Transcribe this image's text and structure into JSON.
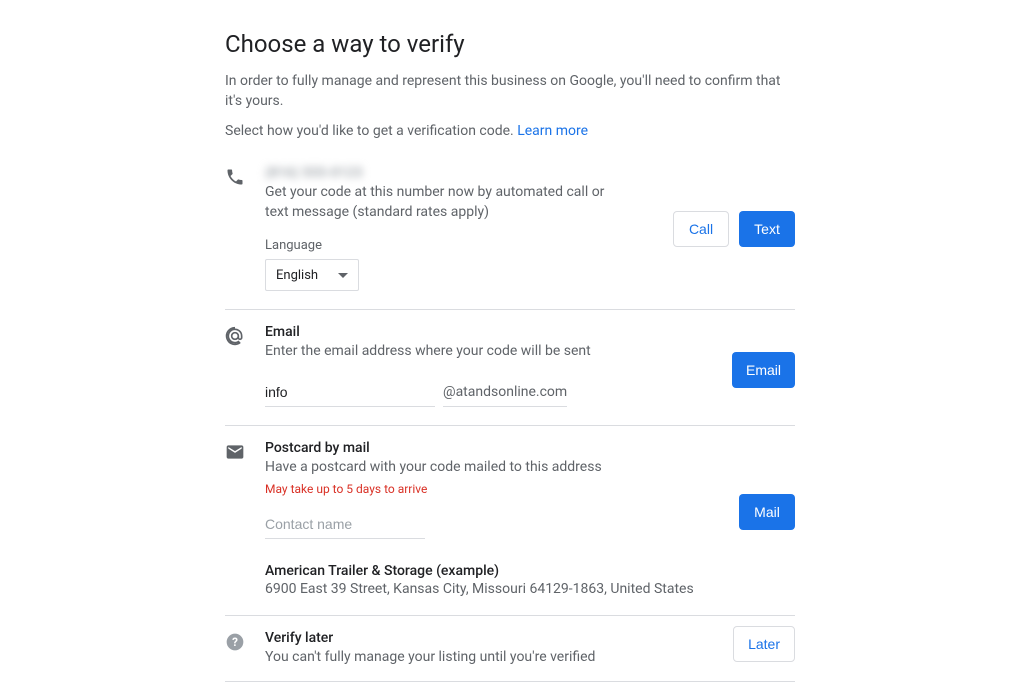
{
  "page": {
    "title": "Choose a way to verify",
    "intro1": "In order to fully manage and represent this business on Google, you'll need to confirm that it's yours.",
    "intro2_prefix": "Select how you'd like to get a verification code. ",
    "learn_more": "Learn more"
  },
  "phone": {
    "number_masked": "(816) 555-0123",
    "desc": "Get your code at this number now by automated call or text message (standard rates apply)",
    "language_label": "Language",
    "language_value": "English",
    "call_btn": "Call",
    "text_btn": "Text"
  },
  "email": {
    "title": "Email",
    "desc": "Enter the email address where your code will be sent",
    "local_value": "info",
    "domain": "@atandsonline.com",
    "btn": "Email"
  },
  "postcard": {
    "title": "Postcard by mail",
    "desc": "Have a postcard with your code mailed to this address",
    "warning": "May take up to 5 days to arrive",
    "contact_placeholder": "Contact name",
    "business_name": "American Trailer & Storage (example)",
    "business_address": "6900 East 39 Street, Kansas City, Missouri 64129-1863, United States",
    "btn": "Mail"
  },
  "later": {
    "title": "Verify later",
    "desc": "You can't fully manage your listing until you're verified",
    "btn": "Later"
  }
}
